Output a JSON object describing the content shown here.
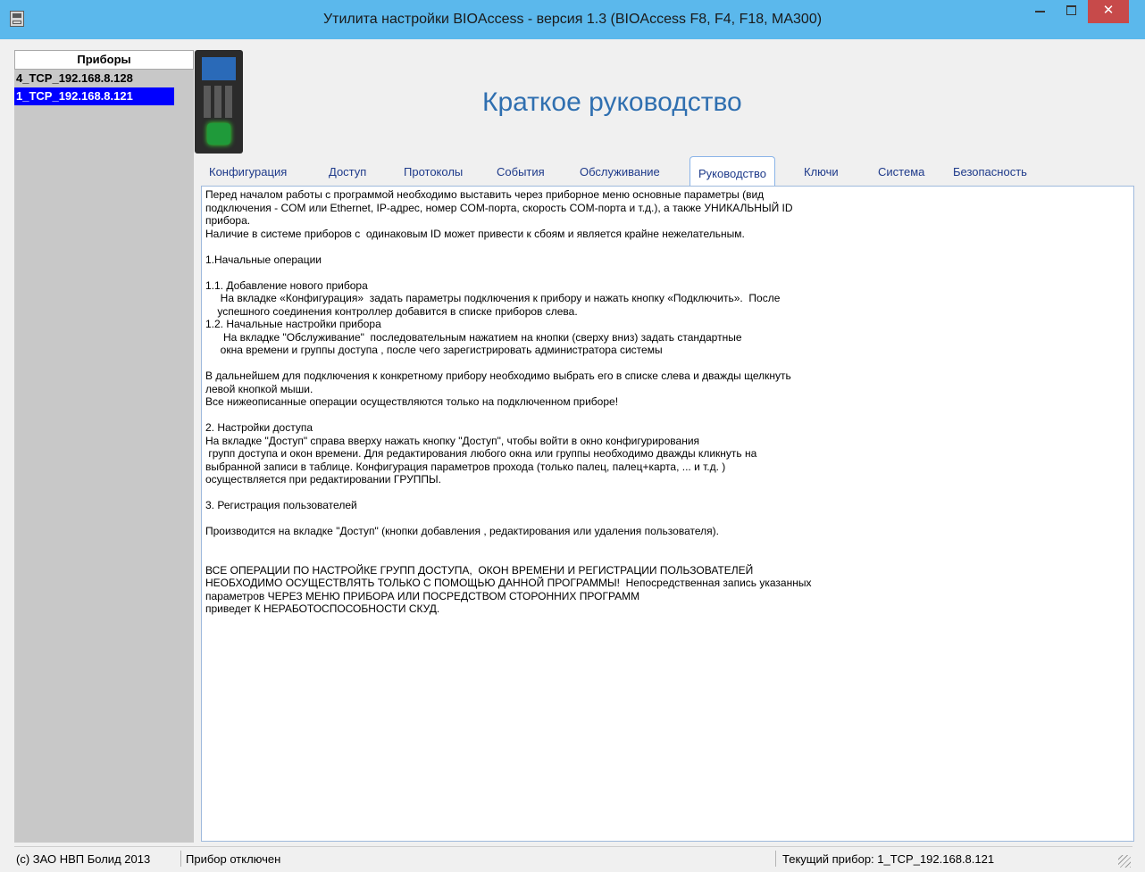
{
  "window": {
    "title": "Утилита настройки BIOAccess - версия 1.3 (BIOAccess F8, F4, F18, MA300)",
    "close_glyph": "✕"
  },
  "sidebar": {
    "header": "Приборы",
    "devices": [
      {
        "label": "4_TCP_192.168.8.128",
        "selected": false
      },
      {
        "label": "1_TCP_192.168.8.121",
        "selected": true
      }
    ]
  },
  "main": {
    "title": "Краткое руководство",
    "tabs": [
      {
        "label": "Конфигурация"
      },
      {
        "label": "Доступ"
      },
      {
        "label": "Протоколы"
      },
      {
        "label": "События"
      },
      {
        "label": "Обслуживание"
      },
      {
        "label": "Руководство"
      },
      {
        "label": "Ключи"
      },
      {
        "label": "Система"
      },
      {
        "label": "Безопасность"
      }
    ],
    "active_tab": "Руководство",
    "guide_lines": [
      "Перед началом работы с программой необходимо выставить через приборное меню основные параметры (вид",
      "подключения - COM или Ethernet, IP-адрес, номер COM-порта, скорость COM-порта и т.д.), а также УНИКАЛЬНЫЙ ID",
      "прибора.",
      "Наличие в системе приборов с  одинаковым ID может привести к сбоям и является крайне нежелательным.",
      "",
      "1.Начальные операции",
      "",
      "1.1. Добавление нового прибора",
      "     На вкладке «Конфигурация»  задать параметры подключения к прибору и нажать кнопку «Подключить».  После",
      "    успешного соединения контроллер добавится в списке приборов слева.",
      "1.2. Начальные настройки прибора",
      "      На вкладке \"Обслуживание\"  последовательным нажатием на кнопки (сверху вниз) задать стандартные",
      "     окна времени и группы доступа , после чего зарегистрировать администратора системы",
      "",
      "В дальнейшем для подключения к конкретному прибору необходимо выбрать его в списке слева и дважды щелкнуть",
      "левой кнопкой мыши.",
      "Все нижеописанные операции осуществляются только на подключенном приборе!",
      "",
      "2. Настройки доступа",
      "На вкладке \"Доступ\" справа вверху нажать кнопку \"Доступ\", чтобы войти в окно конфигурирования",
      " групп доступа и окон времени. Для редактирования любого окна или группы необходимо дважды кликнуть на",
      "выбранной записи в таблице. Конфигурация параметров прохода (только палец, палец+карта, ... и т.д. )",
      "осуществляется при редактировании ГРУППЫ.",
      "",
      "3. Регистрация пользователей",
      "",
      "Производится на вкладке \"Доступ\" (кнопки добавления , редактирования или удаления пользователя).",
      "",
      "",
      "ВСЕ ОПЕРАЦИИ ПО НАСТРОЙКЕ ГРУПП ДОСТУПА,  ОКОН ВРЕМЕНИ И РЕГИСТРАЦИИ ПОЛЬЗОВАТЕЛЕЙ",
      "НЕОБХОДИМО ОСУЩЕСТВЛЯТЬ ТОЛЬКО С ПОМОЩЬЮ ДАННОЙ ПРОГРАММЫ!  Непосредственная запись указанных",
      "параметров ЧЕРЕЗ МЕНЮ ПРИБОРА ИЛИ ПОСРЕДСТВОМ СТОРОННИХ ПРОГРАММ",
      "приведет К НЕРАБОТОСПОСОБНОСТИ СКУД."
    ]
  },
  "statusbar": {
    "copyright": "(с) ЗАО НВП Болид 2013",
    "connection": "Прибор отключен",
    "current_device": "Текущий прибор: 1_TCP_192.168.8.121"
  },
  "colors": {
    "titlebar": "#5bb8ec",
    "close_button": "#c74a4a",
    "selection": "#0000ff",
    "title_text": "#2f6fb0",
    "tab_text": "#1e3a8a"
  },
  "icons": [
    "app-icon",
    "minimize-icon",
    "maximize-icon",
    "close-icon",
    "device-image"
  ]
}
